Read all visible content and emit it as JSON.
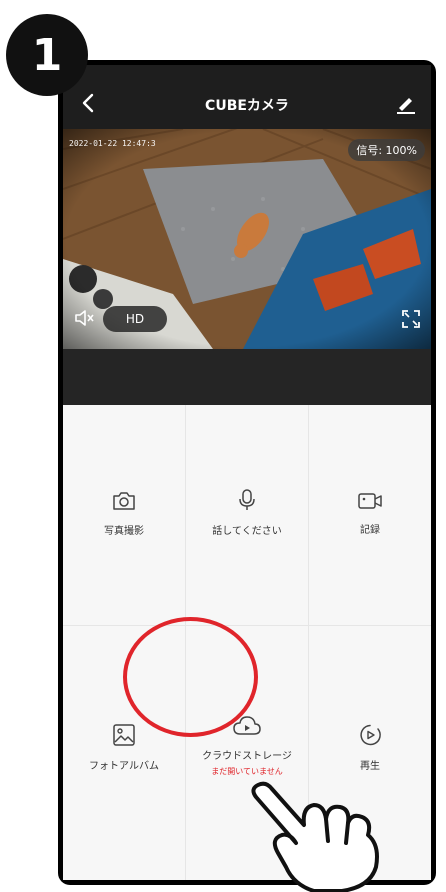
{
  "step": {
    "number": "1"
  },
  "nav": {
    "title": "CUBEカメラ"
  },
  "video": {
    "timestamp": "2022-01-22 12:47:3",
    "signal": "信号: 100%",
    "quality": "HD"
  },
  "actions": [
    {
      "label": "写真撮影",
      "icon": "camera-icon"
    },
    {
      "label": "話してください",
      "icon": "microphone-icon"
    },
    {
      "label": "記録",
      "icon": "video-record-icon"
    },
    {
      "label": "フォトアルバム",
      "icon": "photo-album-icon"
    },
    {
      "label": "クラウドストレージ",
      "sublabel": "まだ開いていません",
      "icon": "cloud-play-icon"
    },
    {
      "label": "再生",
      "icon": "playback-icon"
    }
  ],
  "colors": {
    "accent": "#e0252b",
    "nav_bg": "#1e1e1e",
    "panel_bg": "#f7f7f7"
  }
}
